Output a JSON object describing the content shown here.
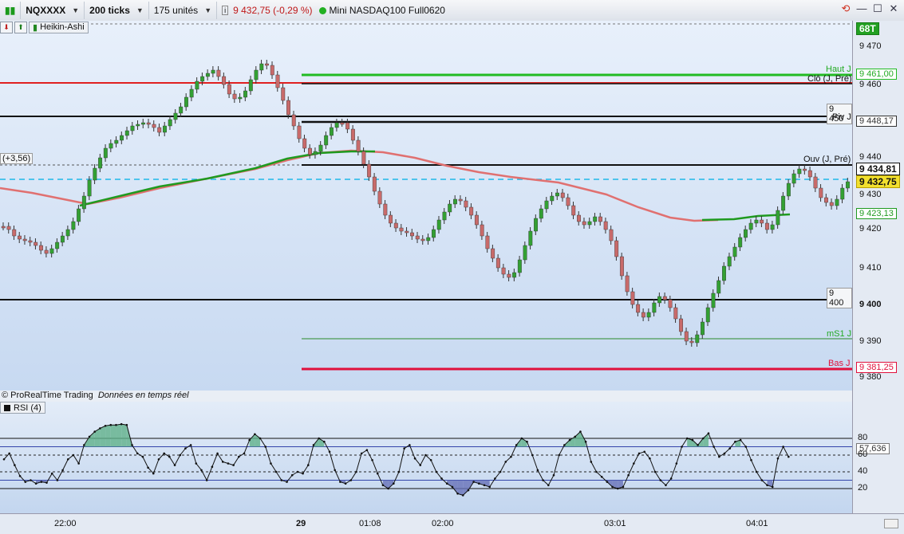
{
  "toolbar": {
    "instrument": "NQXXXX",
    "interval": "200 ticks",
    "units": "175 unités",
    "price": "9 432,75",
    "change": "(-0,29 %)",
    "contract": "Mini NASDAQ100 Full0620"
  },
  "subbar": {
    "chart_style": "Heikin-Ashi"
  },
  "price_panel": {
    "offset_tag": "(+3,56)",
    "corner_badge": "68T",
    "footer": "© ProRealTime Trading",
    "footer_italic": "Données en temps réel",
    "line_labels": {
      "haut": "Haut J",
      "clo": "Clô (J, Pré)",
      "piv": "Piv J",
      "ouv": "Ouv (J, Pré)",
      "ms1": "mS1 J",
      "bas": "Bas J"
    },
    "left_tags": {
      "t9450": "9 450",
      "t9400": "9 400"
    },
    "axis_ticks": [
      "9 470",
      "9 460",
      "9 450",
      "9 440",
      "9 430",
      "9 420",
      "9 410",
      "9 400",
      "9 390",
      "9 380"
    ],
    "badges": {
      "haut": "9 461,00",
      "piv": "9 448,17",
      "ouv": "9 434,81",
      "last": "9 432,75",
      "ma": "9 423,13",
      "bas": "9 381,25"
    },
    "colors": {
      "up": "#33a033",
      "down": "#c86a6a",
      "haut": "#22bb22",
      "bas": "#e0103c",
      "ma_red": "#e07070",
      "ma_green": "#1f9a1f",
      "last_line": "#20b8e8"
    }
  },
  "rsi_panel": {
    "title": "RSI (4)",
    "levels": [
      "80",
      "60",
      "40",
      "20"
    ],
    "value": "57,636"
  },
  "time_axis": [
    "22:00",
    "29",
    "01:08",
    "02:00",
    "03:01",
    "04:01"
  ]
}
